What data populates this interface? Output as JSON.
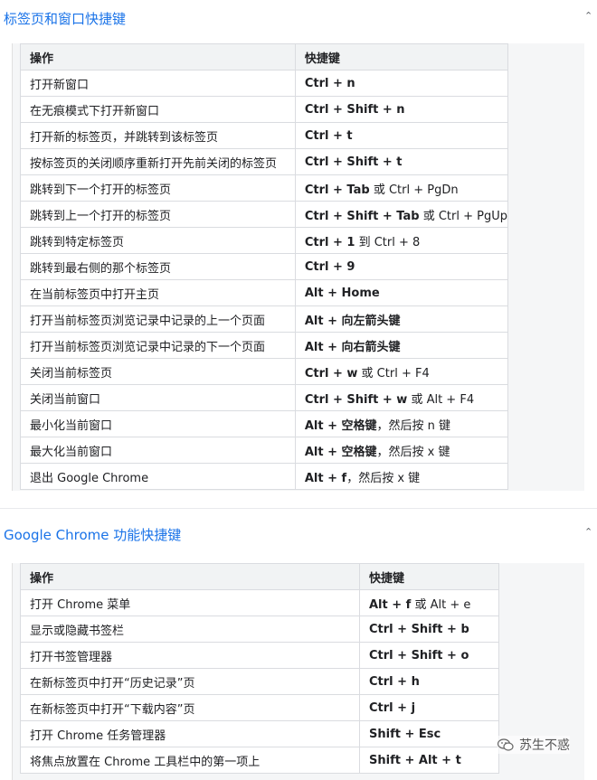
{
  "section1": {
    "title": "标签页和窗口快捷键",
    "columns": [
      "操作",
      "快捷键"
    ],
    "rows": [
      {
        "action": "打开新窗口",
        "key": "Ctrl + n",
        "key_extra": ""
      },
      {
        "action": "在无痕模式下打开新窗口",
        "key": "Ctrl + Shift + n",
        "key_extra": ""
      },
      {
        "action": "打开新的标签页，并跳转到该标签页",
        "key": "Ctrl + t",
        "key_extra": ""
      },
      {
        "action": "按标签页的关闭顺序重新打开先前关闭的标签页",
        "key": "Ctrl + Shift + t",
        "key_extra": ""
      },
      {
        "action": "跳转到下一个打开的标签页",
        "key": "Ctrl + Tab",
        "key_extra": " 或 Ctrl + PgDn"
      },
      {
        "action": "跳转到上一个打开的标签页",
        "key": "Ctrl + Shift + Tab",
        "key_extra": " 或 Ctrl + PgUp"
      },
      {
        "action": "跳转到特定标签页",
        "key": "Ctrl + 1",
        "key_extra": " 到 Ctrl + 8"
      },
      {
        "action": "跳转到最右侧的那个标签页",
        "key": "Ctrl + 9",
        "key_extra": ""
      },
      {
        "action": "在当前标签页中打开主页",
        "key": "Alt + Home",
        "key_extra": ""
      },
      {
        "action": "打开当前标签页浏览记录中记录的上一个页面",
        "key": "Alt + 向左箭头键",
        "key_extra": ""
      },
      {
        "action": "打开当前标签页浏览记录中记录的下一个页面",
        "key": "Alt + 向右箭头键",
        "key_extra": ""
      },
      {
        "action": "关闭当前标签页",
        "key": "Ctrl + w",
        "key_extra": " 或 Ctrl + F4"
      },
      {
        "action": "关闭当前窗口",
        "key": "Ctrl + Shift + w",
        "key_extra": " 或 Alt + F4"
      },
      {
        "action": "最小化当前窗口",
        "key": "Alt + 空格键",
        "key_extra": "，然后按 n 键"
      },
      {
        "action": "最大化当前窗口",
        "key": "Alt + 空格键",
        "key_extra": "，然后按 x 键"
      },
      {
        "action": "退出 Google Chrome",
        "key": "Alt + f",
        "key_extra": "，然后按 x 键"
      }
    ]
  },
  "section2": {
    "title": "Google Chrome 功能快捷键",
    "columns": [
      "操作",
      "快捷键"
    ],
    "rows": [
      {
        "action": "打开 Chrome 菜单",
        "key": "Alt + f",
        "key_extra": " 或 Alt + e"
      },
      {
        "action": "显示或隐藏书签栏",
        "key": "Ctrl + Shift + b",
        "key_extra": ""
      },
      {
        "action": "打开书签管理器",
        "key": "Ctrl + Shift + o",
        "key_extra": ""
      },
      {
        "action": "在新标签页中打开“历史记录”页",
        "key": "Ctrl + h",
        "key_extra": ""
      },
      {
        "action": "在新标签页中打开“下载内容”页",
        "key": "Ctrl + j",
        "key_extra": ""
      },
      {
        "action": "打开 Chrome 任务管理器",
        "key": "Shift + Esc",
        "key_extra": ""
      },
      {
        "action": "将焦点放置在 Chrome 工具栏中的第一项上",
        "key": "Shift + Alt + t",
        "key_extra": ""
      }
    ]
  },
  "watermark": {
    "text": "苏生不惑",
    "icon": "wechat-icon"
  }
}
